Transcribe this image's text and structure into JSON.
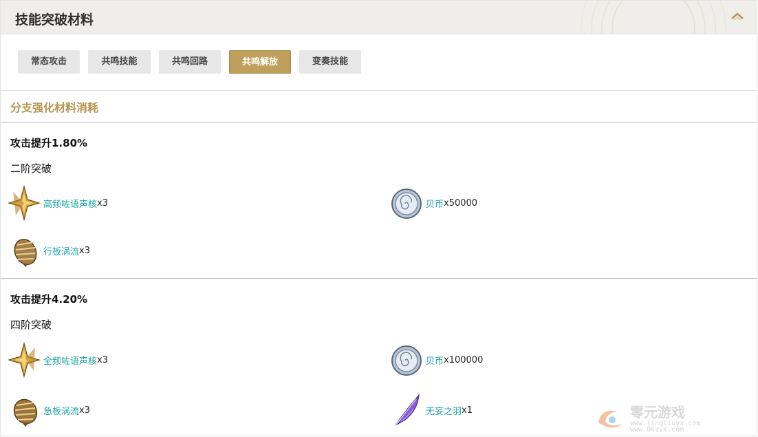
{
  "header": {
    "title": "技能突破材料"
  },
  "icons": {
    "collapse": "chevron-up-icon"
  },
  "colors": {
    "accent": "#bf9f5c",
    "link": "#1aa5a5",
    "section": "#b59451"
  },
  "tabs": [
    {
      "label": "常态攻击",
      "active": false
    },
    {
      "label": "共鸣技能",
      "active": false
    },
    {
      "label": "共鸣回路",
      "active": false
    },
    {
      "label": "共鸣解放",
      "active": true
    },
    {
      "label": "变奏技能",
      "active": false
    }
  ],
  "section_title": "分支强化材料消耗",
  "stages": [
    {
      "title": "攻击提升1.80%",
      "subtitle": "二阶突破",
      "materials": [
        {
          "name": "高频咗语声核",
          "qty": "x3",
          "icon": "star-core-icon"
        },
        {
          "name": "贝币",
          "qty": "x50000",
          "icon": "shell-coin-icon"
        },
        {
          "name": "行板涡流",
          "qty": "x3",
          "icon": "spiral-shell-icon"
        }
      ]
    },
    {
      "title": "攻击提升4.20%",
      "subtitle": "四阶突破",
      "materials": [
        {
          "name": "全频咗语声核",
          "qty": "x3",
          "icon": "star-core-icon"
        },
        {
          "name": "贝币",
          "qty": "x100000",
          "icon": "shell-coin-icon"
        },
        {
          "name": "急板涡流",
          "qty": "x3",
          "icon": "spiral-shell-icon"
        },
        {
          "name": "无妄之羽",
          "qty": "x1",
          "icon": "feather-icon"
        }
      ]
    }
  ],
  "watermark": {
    "brand": "零元游戏",
    "url1": "www.lingliuyx.com",
    "url2": "www.06zyx.com"
  }
}
